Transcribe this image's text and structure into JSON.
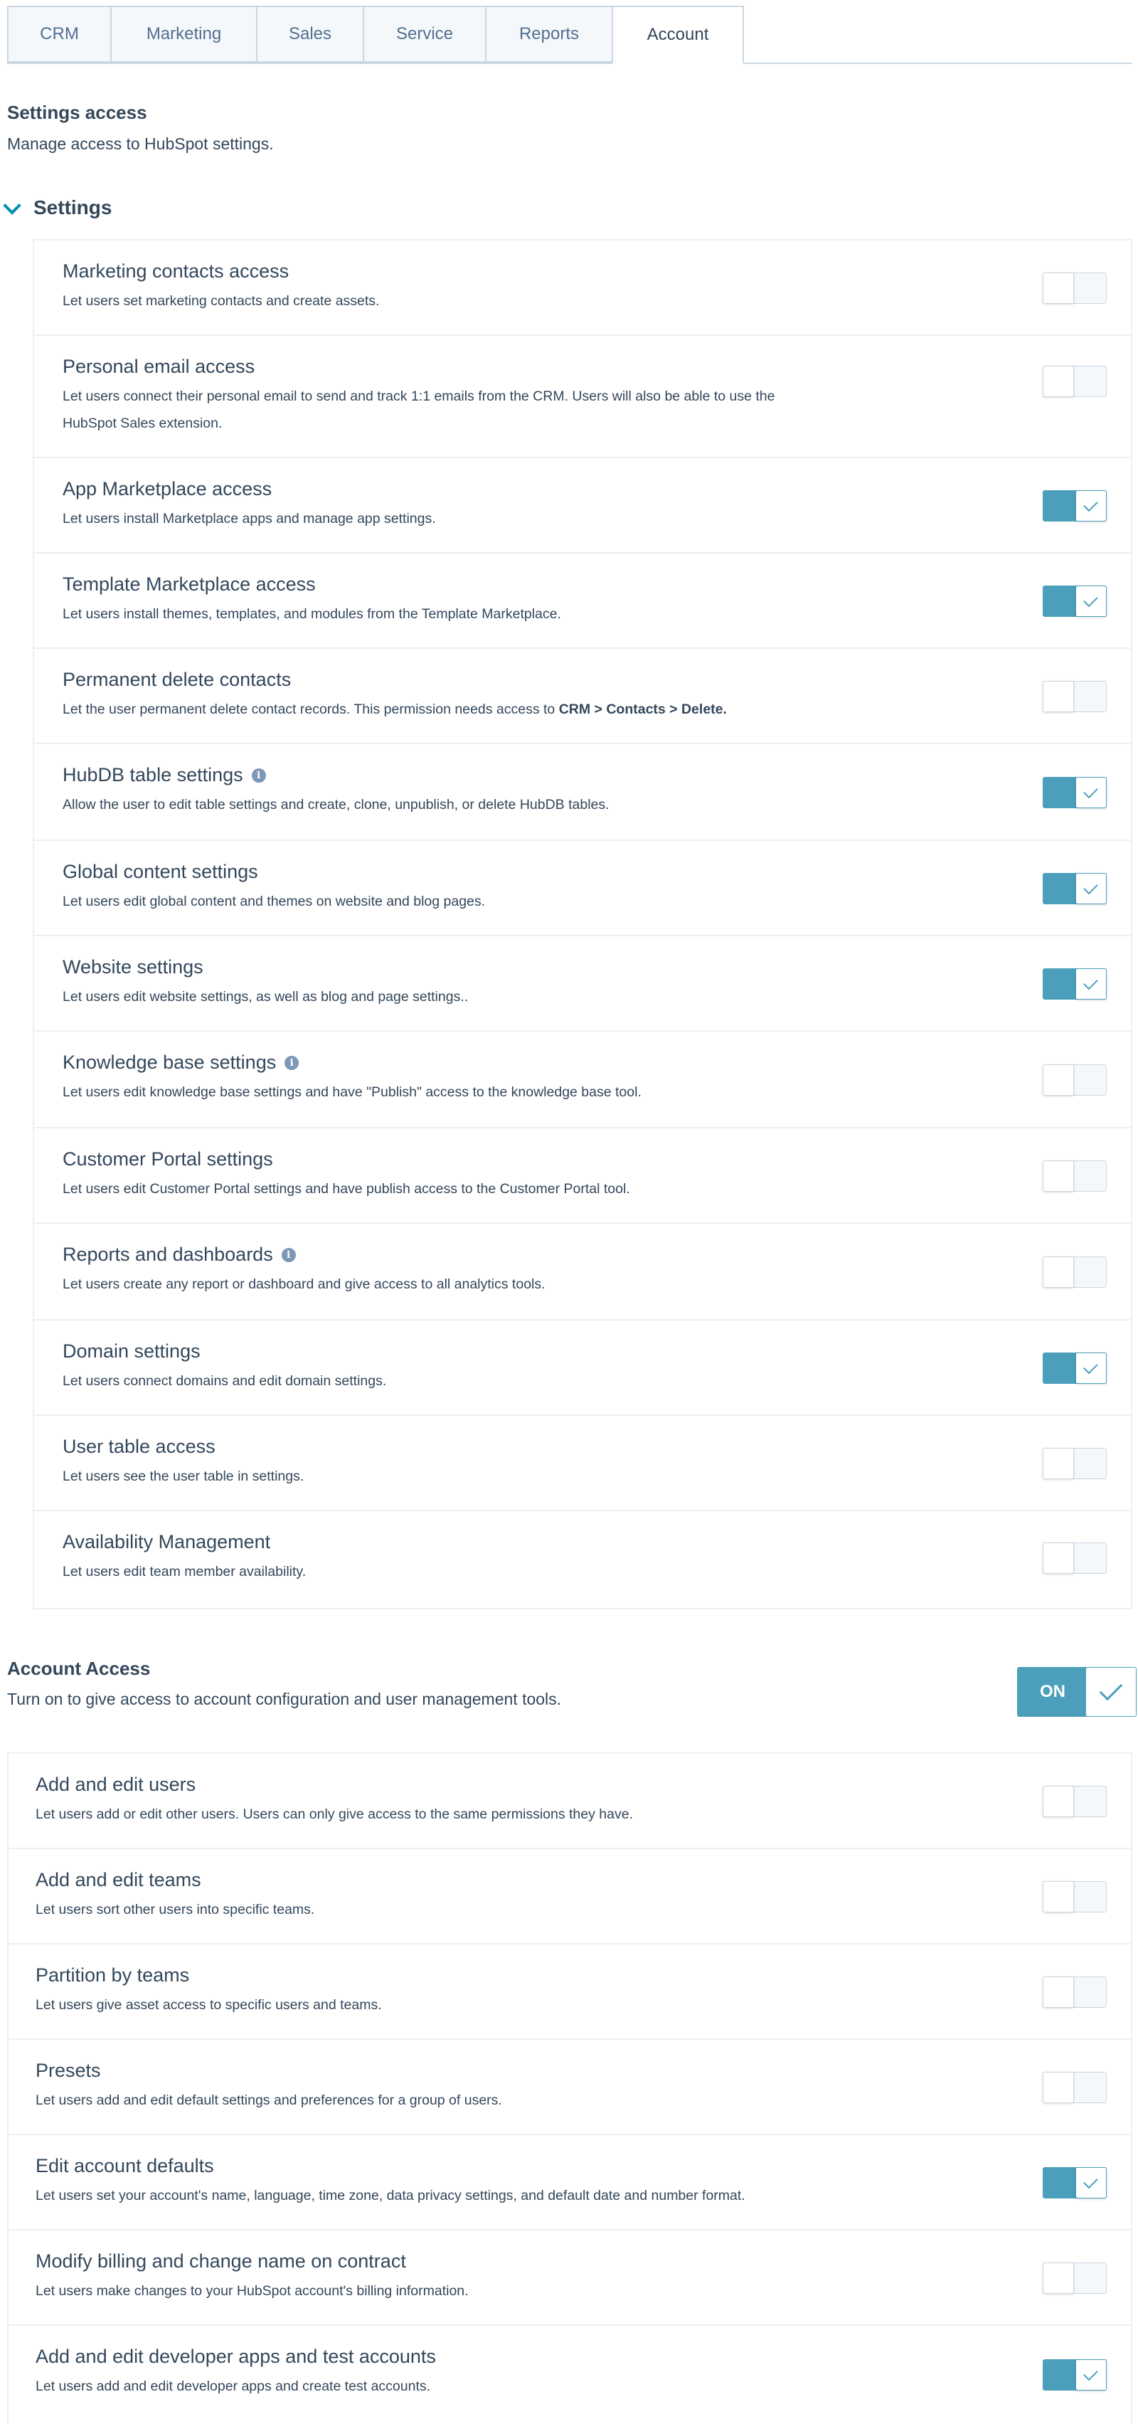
{
  "tabs": [
    {
      "label": "CRM",
      "active": false
    },
    {
      "label": "Marketing",
      "active": false
    },
    {
      "label": "Sales",
      "active": false
    },
    {
      "label": "Service",
      "active": false
    },
    {
      "label": "Reports",
      "active": false
    },
    {
      "label": "Account",
      "active": true
    }
  ],
  "settings_access": {
    "title": "Settings access",
    "description": "Manage access to HubSpot settings.",
    "group_title": "Settings",
    "items": [
      {
        "title": "Marketing contacts access",
        "description": "Let users set marketing contacts and create assets.",
        "enabled": false,
        "info": false
      },
      {
        "title": "Personal email access",
        "description": "Let users connect their personal email to send and track 1:1 emails from the CRM. Users will also be able to use the",
        "description2": "HubSpot Sales extension.",
        "enabled": false,
        "info": false
      },
      {
        "title": "App Marketplace access",
        "description": "Let users install Marketplace apps and manage app settings.",
        "enabled": true,
        "info": false
      },
      {
        "title": "Template Marketplace access",
        "description": "Let users install themes, templates, and modules from the Template Marketplace.",
        "enabled": true,
        "info": false
      },
      {
        "title": "Permanent delete contacts",
        "description": "Let the user permanent delete contact records. This permission needs access to",
        "description_bold": "CRM > Contacts > Delete.",
        "enabled": false,
        "info": false
      },
      {
        "title": "HubDB table settings",
        "description": "Allow the user to edit table settings and create, clone, unpublish, or delete HubDB tables.",
        "enabled": true,
        "info": true
      },
      {
        "title": "Global content settings",
        "description": "Let users edit global content and themes on website and blog pages.",
        "enabled": true,
        "info": false
      },
      {
        "title": "Website settings",
        "description": "Let users edit website settings, as well as blog and page settings..",
        "enabled": true,
        "info": false
      },
      {
        "title": "Knowledge base settings",
        "description": "Let users edit knowledge base settings and have \"Publish\" access to the knowledge base tool.",
        "enabled": false,
        "info": true
      },
      {
        "title": "Customer Portal settings",
        "description": "Let users edit Customer Portal settings and have publish access to the Customer Portal tool.",
        "enabled": false,
        "info": false
      },
      {
        "title": "Reports and dashboards",
        "description": "Let users create any report or dashboard and give access to all analytics tools.",
        "enabled": false,
        "info": true
      },
      {
        "title": "Domain settings",
        "description": "Let users connect domains and edit domain settings.",
        "enabled": true,
        "info": false
      },
      {
        "title": "User table access",
        "description": "Let users see the user table in settings.",
        "enabled": false,
        "info": false
      },
      {
        "title": "Availability Management",
        "description": "Let users edit team member availability.",
        "enabled": false,
        "info": false
      }
    ]
  },
  "account_access": {
    "title": "Account Access",
    "description": "Turn on to give access to account configuration and user management tools.",
    "toggle_label": "ON",
    "enabled": true,
    "items": [
      {
        "title": "Add and edit users",
        "description": "Let users add or edit other users. Users can only give access to the same permissions they have.",
        "enabled": false
      },
      {
        "title": "Add and edit teams",
        "description": "Let users sort other users into specific teams.",
        "enabled": false
      },
      {
        "title": "Partition by teams",
        "description": "Let users give asset access to specific users and teams.",
        "enabled": false
      },
      {
        "title": "Presets",
        "description": "Let users add and edit default settings and preferences for a group of users.",
        "enabled": false
      },
      {
        "title": "Edit account defaults",
        "description": "Let users set your account's name, language, time zone, data privacy settings, and default date and number format.",
        "enabled": true
      },
      {
        "title": "Modify billing and change name on contract",
        "description": "Let users make changes to your HubSpot account's billing information.",
        "enabled": false
      },
      {
        "title": "Add and edit developer apps and test accounts",
        "description": "Let users add and edit developer apps and create test accounts.",
        "enabled": true
      }
    ]
  },
  "colors": {
    "accent": "#4b9fbb",
    "link": "#0091ae",
    "text": "#33475b",
    "border": "#eaf0f6"
  }
}
